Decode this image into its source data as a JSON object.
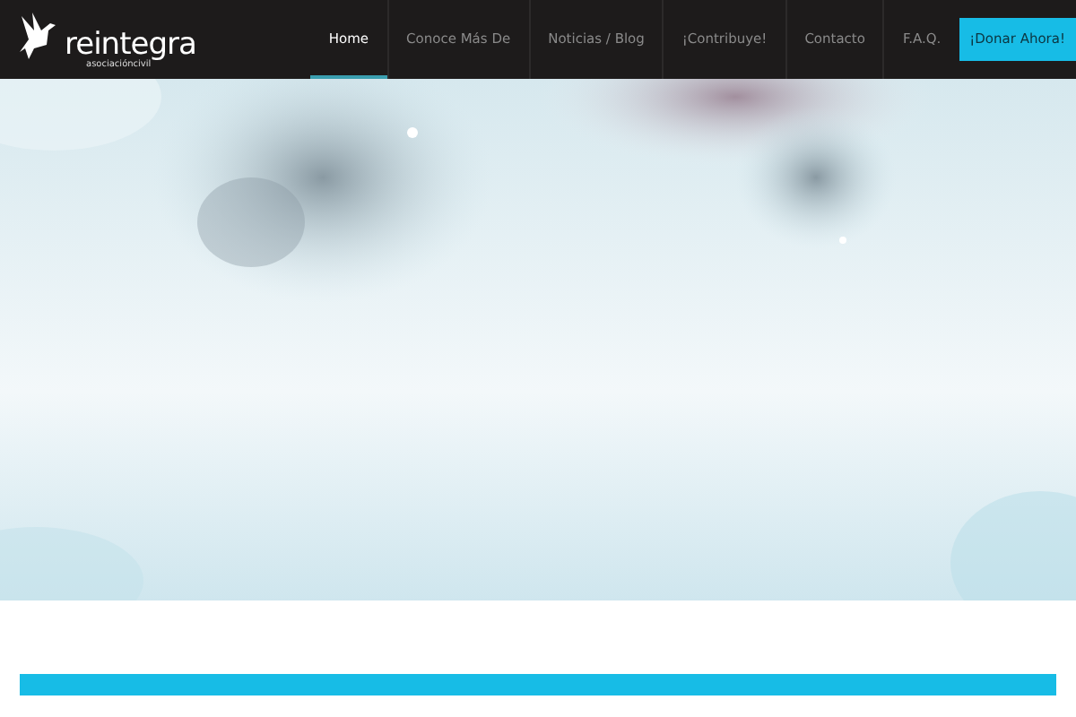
{
  "logo": {
    "name": "reintegra",
    "tagline": "asociacióncivil"
  },
  "nav": [
    {
      "label": "Home",
      "selected": true
    },
    {
      "label": "Conoce Más De",
      "selected": false
    },
    {
      "label": "Noticias / Blog",
      "selected": false
    },
    {
      "label": "¡Contribuye!",
      "selected": false
    },
    {
      "label": "Contacto",
      "selected": false
    },
    {
      "label": "F.A.Q.",
      "selected": false
    }
  ],
  "cta": "¡Donar Ahora!"
}
